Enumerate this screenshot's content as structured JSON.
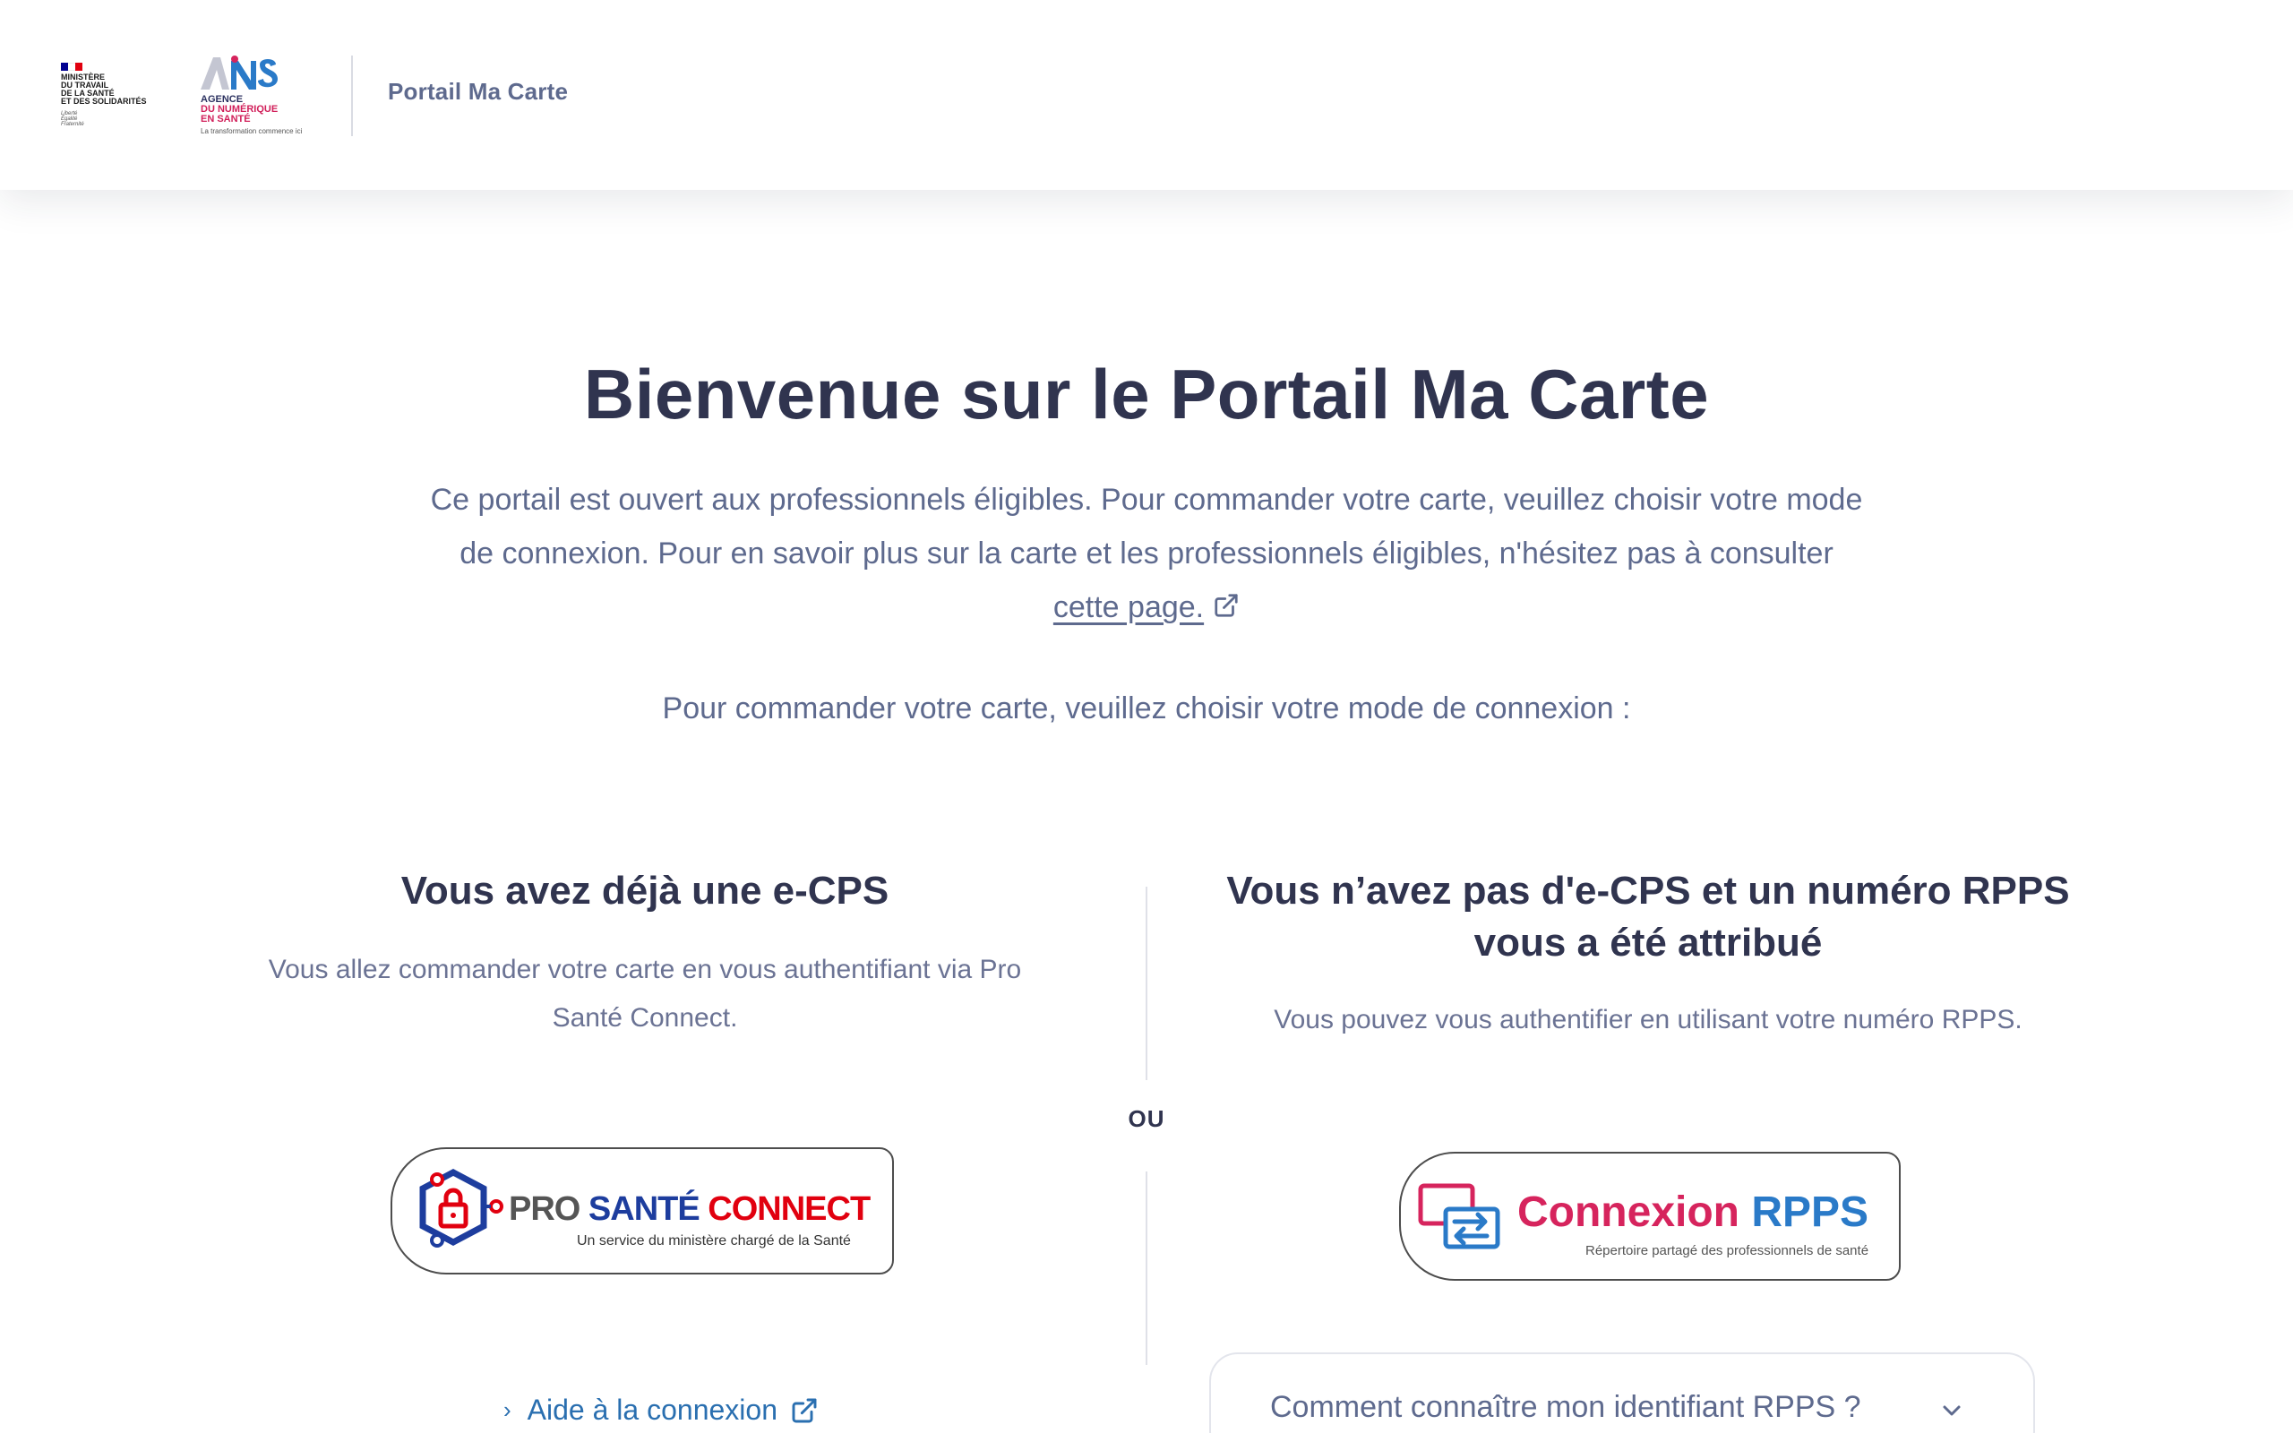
{
  "header": {
    "ministry": {
      "lines": [
        "MINISTÈRE",
        "DU TRAVAIL",
        "DE LA SANTÉ",
        "ET DES SOLIDARITÉS"
      ],
      "motto": [
        "Liberté",
        "Égalité",
        "Fraternité"
      ],
      "flag_colors": [
        "#000091",
        "#ffffff",
        "#e1000f"
      ]
    },
    "ans": {
      "mark_colors": [
        "#c4c6d2",
        "#2a7ac8",
        "#d6245d"
      ],
      "line1": "AGENCE",
      "line2": "DU NUMÉRIQUE",
      "line3": "EN SANTÉ",
      "tagline": "La transformation commence ici"
    },
    "portal_name": "Portail Ma Carte"
  },
  "hero": {
    "title": "Bienvenue sur le Portail Ma Carte",
    "intro_text": "Ce portail est ouvert aux professionnels éligibles. Pour commander votre carte, veuillez choisir votre mode de connexion. Pour en savoir plus sur la carte et les professionnels éligibles, n'hésitez pas à consulter ",
    "intro_link": "cette page.",
    "choose_text": "Pour commander votre carte, veuillez choisir votre mode de connexion :"
  },
  "left": {
    "title": "Vous avez déjà une e-CPS",
    "description": "Vous allez commander votre carte en vous authentifiant via Pro Santé Connect.",
    "button": {
      "pro": "PRO ",
      "sante": "SANTÉ ",
      "connect": "CONNECT",
      "subtitle": "Un service du ministère chargé de la Santé"
    },
    "help_link": "Aide à la connexion"
  },
  "separator": "OU",
  "right": {
    "title": "Vous n’avez pas d'e-CPS et un numéro RPPS vous a été attribué",
    "description": "Vous pouvez vous authentifier en utilisant votre numéro RPPS.",
    "button": {
      "connexion": "Connexion ",
      "rpps": "RPPS",
      "subtitle": "Répertoire partagé des professionnels de santé"
    },
    "accordion_label": "Comment connaître mon identifiant RPPS ?"
  },
  "colors": {
    "title": "#30344f",
    "body_text": "#5e6a8e",
    "link_blue": "#2a6fb0",
    "psc_blue": "#1d3d9e",
    "psc_red": "#e1000f",
    "rpps_pink": "#d6245d",
    "rpps_blue": "#2a7ac8"
  },
  "icons": [
    "external-link-icon",
    "chevron-right-icon",
    "chevron-down-icon",
    "lock-icon",
    "transfer-icon"
  ]
}
